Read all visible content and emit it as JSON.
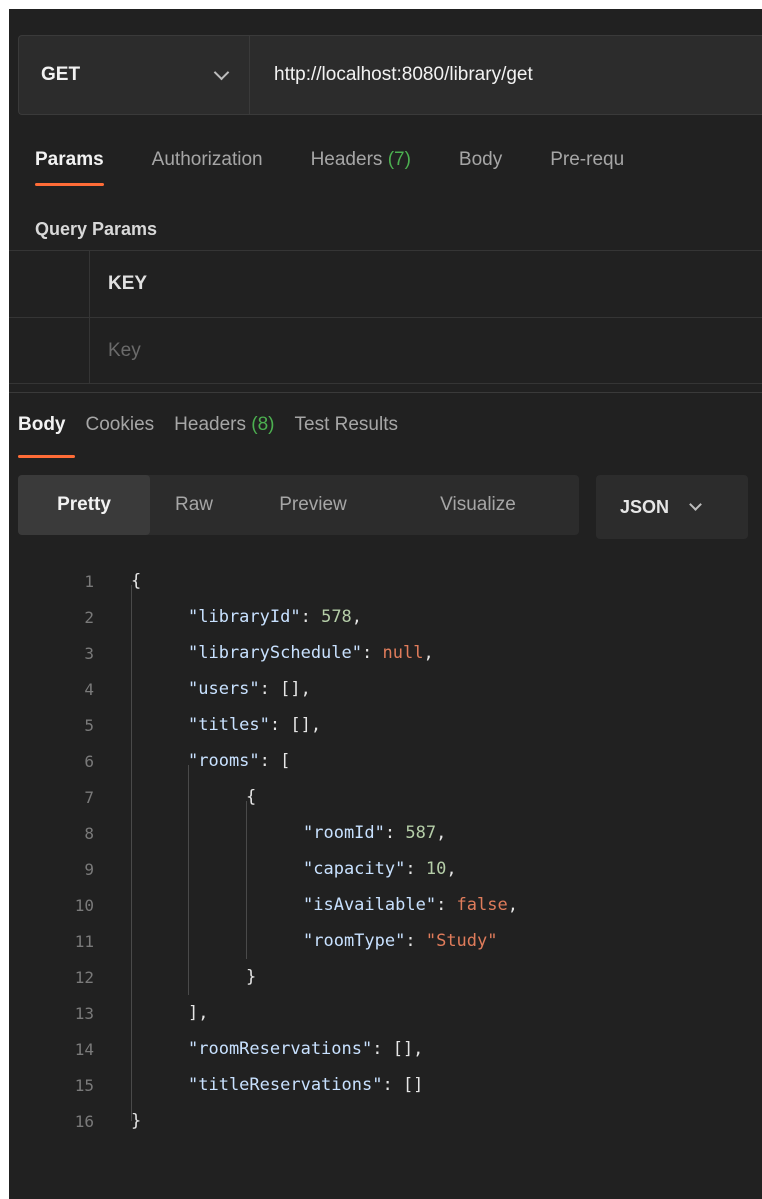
{
  "request": {
    "method": "GET",
    "url": "http://localhost:8080/library/get"
  },
  "request_tabs": [
    {
      "label": "Params",
      "count": "",
      "active": true
    },
    {
      "label": "Authorization",
      "count": "",
      "active": false
    },
    {
      "label": "Headers ",
      "count": "(7)",
      "active": false
    },
    {
      "label": "Body",
      "count": "",
      "active": false
    },
    {
      "label": "Pre-requ",
      "count": "",
      "active": false
    }
  ],
  "query_params": {
    "title": "Query Params",
    "column_key": "KEY",
    "key_placeholder": "Key"
  },
  "response_tabs": [
    {
      "label": "Body",
      "count": "",
      "active": true
    },
    {
      "label": "Cookies",
      "count": "",
      "active": false
    },
    {
      "label": "Headers ",
      "count": "(8)",
      "active": false
    },
    {
      "label": "Test Results",
      "count": "",
      "active": false
    }
  ],
  "view_modes": [
    "Pretty",
    "Raw",
    "Preview",
    "Visualize"
  ],
  "format": "JSON",
  "code_lines": [
    {
      "n": "1",
      "indent": 0,
      "parts": [
        [
          "punct",
          "{"
        ]
      ]
    },
    {
      "n": "2",
      "indent": 1,
      "parts": [
        [
          "k",
          "\"libraryId\""
        ],
        [
          "punct",
          ": "
        ],
        [
          "num",
          "578"
        ],
        [
          "punct",
          ","
        ]
      ]
    },
    {
      "n": "3",
      "indent": 1,
      "parts": [
        [
          "k",
          "\"librarySchedule\""
        ],
        [
          "punct",
          ": "
        ],
        [
          "null",
          "null"
        ],
        [
          "punct",
          ","
        ]
      ]
    },
    {
      "n": "4",
      "indent": 1,
      "parts": [
        [
          "k",
          "\"users\""
        ],
        [
          "punct",
          ": [],"
        ]
      ]
    },
    {
      "n": "5",
      "indent": 1,
      "parts": [
        [
          "k",
          "\"titles\""
        ],
        [
          "punct",
          ": [],"
        ]
      ]
    },
    {
      "n": "6",
      "indent": 1,
      "parts": [
        [
          "k",
          "\"rooms\""
        ],
        [
          "punct",
          ": ["
        ]
      ]
    },
    {
      "n": "7",
      "indent": 2,
      "parts": [
        [
          "punct",
          "{"
        ]
      ]
    },
    {
      "n": "8",
      "indent": 3,
      "parts": [
        [
          "k",
          "\"roomId\""
        ],
        [
          "punct",
          ": "
        ],
        [
          "num",
          "587"
        ],
        [
          "punct",
          ","
        ]
      ]
    },
    {
      "n": "9",
      "indent": 3,
      "parts": [
        [
          "k",
          "\"capacity\""
        ],
        [
          "punct",
          ": "
        ],
        [
          "num",
          "10"
        ],
        [
          "punct",
          ","
        ]
      ]
    },
    {
      "n": "10",
      "indent": 3,
      "parts": [
        [
          "k",
          "\"isAvailable\""
        ],
        [
          "punct",
          ": "
        ],
        [
          "kw",
          "false"
        ],
        [
          "punct",
          ","
        ]
      ]
    },
    {
      "n": "11",
      "indent": 3,
      "parts": [
        [
          "k",
          "\"roomType\""
        ],
        [
          "punct",
          ": "
        ],
        [
          "str",
          "\"Study\""
        ]
      ]
    },
    {
      "n": "12",
      "indent": 2,
      "parts": [
        [
          "punct",
          "}"
        ]
      ]
    },
    {
      "n": "13",
      "indent": 1,
      "parts": [
        [
          "punct",
          "],"
        ]
      ]
    },
    {
      "n": "14",
      "indent": 1,
      "parts": [
        [
          "k",
          "\"roomReservations\""
        ],
        [
          "punct",
          ": [],"
        ]
      ]
    },
    {
      "n": "15",
      "indent": 1,
      "parts": [
        [
          "k",
          "\"titleReservations\""
        ],
        [
          "punct",
          ": []"
        ]
      ]
    },
    {
      "n": "16",
      "indent": 0,
      "parts": [
        [
          "punct",
          "}"
        ]
      ]
    }
  ]
}
